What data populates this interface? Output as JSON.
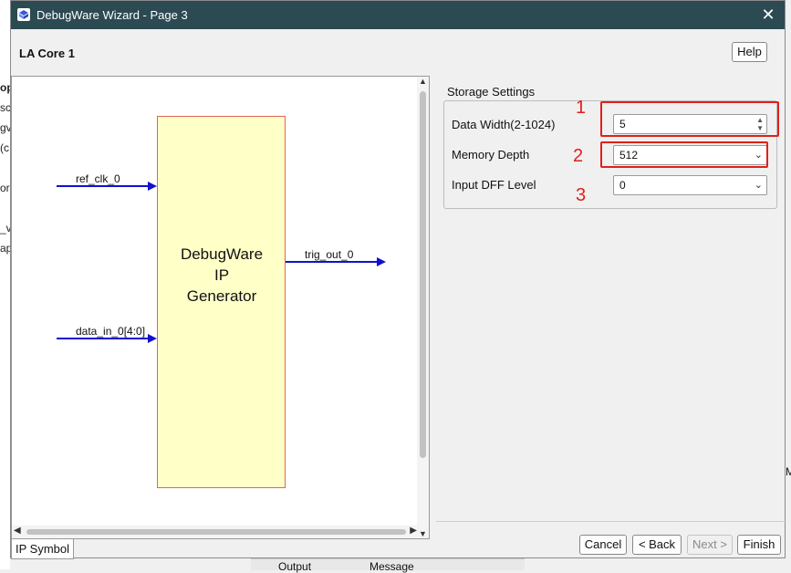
{
  "window": {
    "title": "DebugWare Wizard - Page 3"
  },
  "header": {
    "label": "LA Core 1",
    "help": "Help"
  },
  "diagram": {
    "block_lines": [
      "DebugWare",
      "IP",
      "Generator"
    ],
    "inputs": [
      "ref_clk_0",
      "data_in_0[4:0]"
    ],
    "outputs": [
      "trig_out_0"
    ]
  },
  "tab": {
    "label": "IP Symbol"
  },
  "storage": {
    "title": "Storage Settings",
    "data_width": {
      "label": "Data Width(2-1024)",
      "value": "5"
    },
    "memory_depth": {
      "label": "Memory Depth",
      "value": "512"
    },
    "input_dff": {
      "label": "Input DFF Level",
      "value": "0"
    }
  },
  "annotations": [
    "1",
    "2",
    "3"
  ],
  "buttons": {
    "cancel": "Cancel",
    "back": "< Back",
    "next": "Next >",
    "finish": "Finish"
  },
  "background": {
    "left_fragments": [
      "op",
      "sc",
      "gv",
      "(c",
      "or",
      "_v",
      "ap"
    ],
    "bottom_tabs": [
      "Output",
      "Message"
    ],
    "right_fragment": "M"
  },
  "colors": {
    "titlebar": "#2c4a52",
    "wire": "#1010d0",
    "block_fill": "#ffffc8",
    "highlight": "#e0201a"
  }
}
